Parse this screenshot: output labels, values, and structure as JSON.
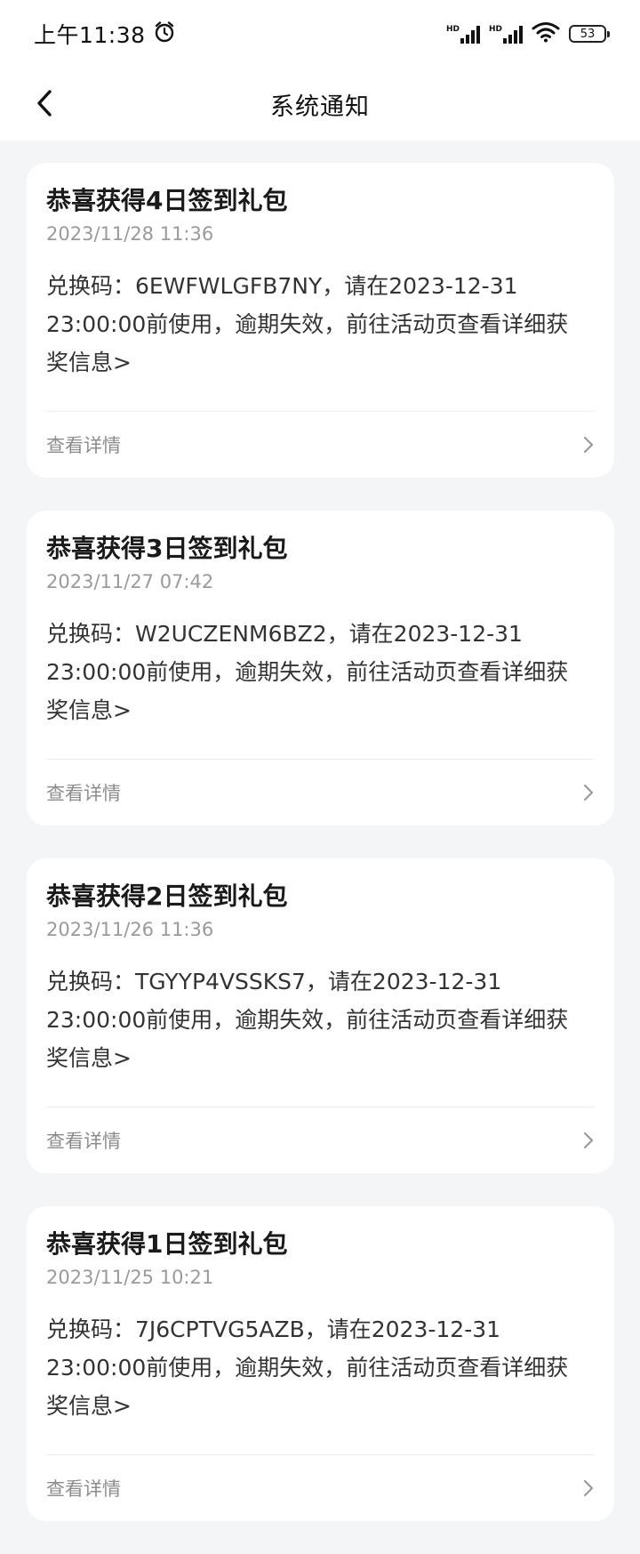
{
  "status_bar": {
    "time": "上午11:38",
    "signal_label_1": "HD",
    "signal_label_2": "HD",
    "battery": "53"
  },
  "header": {
    "title": "系统通知"
  },
  "notifications": [
    {
      "title": "恭喜获得4日签到礼包",
      "time": "2023/11/28 11:36",
      "body": "兑换码：6EWFWLGFB7NY，请在2023-12-31 23:00:00前使用，逾期失效，前往活动页查看详细获奖信息>",
      "detail_label": "查看详情"
    },
    {
      "title": "恭喜获得3日签到礼包",
      "time": "2023/11/27 07:42",
      "body": "兑换码：W2UCZENM6BZ2，请在2023-12-31 23:00:00前使用，逾期失效，前往活动页查看详细获奖信息>",
      "detail_label": "查看详情"
    },
    {
      "title": "恭喜获得2日签到礼包",
      "time": "2023/11/26 11:36",
      "body": "兑换码：TGYYP4VSSKS7，请在2023-12-31 23:00:00前使用，逾期失效，前往活动页查看详细获奖信息>",
      "detail_label": "查看详情"
    },
    {
      "title": "恭喜获得1日签到礼包",
      "time": "2023/11/25 10:21",
      "body": "兑换码：7J6CPTVG5AZB，请在2023-12-31 23:00:00前使用，逾期失效，前往活动页查看详细获奖信息>",
      "detail_label": "查看详情"
    }
  ],
  "colors": {
    "page_background": "#f4f5f7",
    "card_background": "#ffffff",
    "title_text": "#1a1a1a",
    "secondary_text": "#9a9a9a"
  },
  "icons": {
    "back": "chevron-left-icon",
    "alarm": "alarm-clock-icon",
    "wifi": "wifi-icon",
    "detail_arrow": "chevron-right-icon"
  }
}
